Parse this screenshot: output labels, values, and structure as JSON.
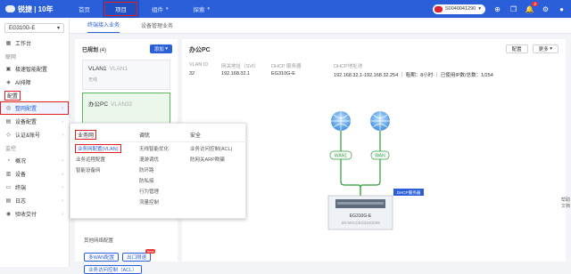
{
  "header": {
    "logo_text": "锐捷 | 10年",
    "nav": [
      "首页",
      "项目",
      "组件",
      "探索"
    ],
    "device_id": "S0040041290"
  },
  "icons": {
    "help": "plus-circle-icon",
    "copy": "copy-icon",
    "bell": "bell-icon",
    "notif_count": "2",
    "settings": "gear-icon",
    "user": "user-icon"
  },
  "sidebar": {
    "device": "EG310G-E",
    "workspace": "工作台",
    "group_label": "联网",
    "items_net": [
      "极速智能配置",
      "AI排障"
    ],
    "ai_badge": "New",
    "config_label": "配置",
    "items_config": [
      "整网配置",
      "设备配置",
      "认证&账号"
    ],
    "monitor_label": "监控",
    "items_monitor": [
      "概况",
      "设备",
      "终端",
      "日志",
      "验收交付"
    ]
  },
  "tabs": [
    "终端接入业务",
    "设备管理业务"
  ],
  "left_panel": {
    "title": "已规划",
    "count": "(4)",
    "add": "添加",
    "vlans": [
      {
        "name": "VLAN1",
        "alias": "VLAN1",
        "sub": "无线"
      },
      {
        "name": "办公PC",
        "alias": "VLAN32",
        "sub": ""
      }
    ],
    "bottom_label": "其他网络配置",
    "buttons": [
      "多WAN配置",
      "出口限速",
      "业务访问控制（ACL）"
    ],
    "new_badge": "New"
  },
  "detail": {
    "title": "办公PC",
    "btn_config": "配置",
    "btn_more": "更多",
    "headers": [
      "VLAN ID",
      "网关地址（SVI）",
      "DHCP 服务器",
      "DHCP地址池"
    ],
    "values": [
      "32",
      "192.168.32.1",
      "EG310G-E",
      "192.168.32.1-192.168.32.254 ｜ 租期：8小时 ｜ 已使用IP数/总数：1/254"
    ]
  },
  "topology": {
    "wan_labels": [
      "WAN1",
      "WAN"
    ],
    "dhcp_label": "DHCP服务器",
    "device_name": "EG310G-E",
    "device_sn": "SN:MACCEG310GE99"
  },
  "menu": {
    "cols": [
      {
        "head": "业务网",
        "items": [
          "业务网配置(VLAN)",
          "业务远程配置",
          "智能设备网"
        ]
      },
      {
        "head": "调优",
        "items": [
          "无线智能优化",
          "漫游调优",
          "防环路",
          "防私接",
          "行为管理",
          "流量控制"
        ]
      },
      {
        "head": "安全",
        "items": [
          "业务访问控制(ACL)",
          "防网关ARP欺骗"
        ]
      }
    ]
  },
  "help_float": "帮助文档"
}
